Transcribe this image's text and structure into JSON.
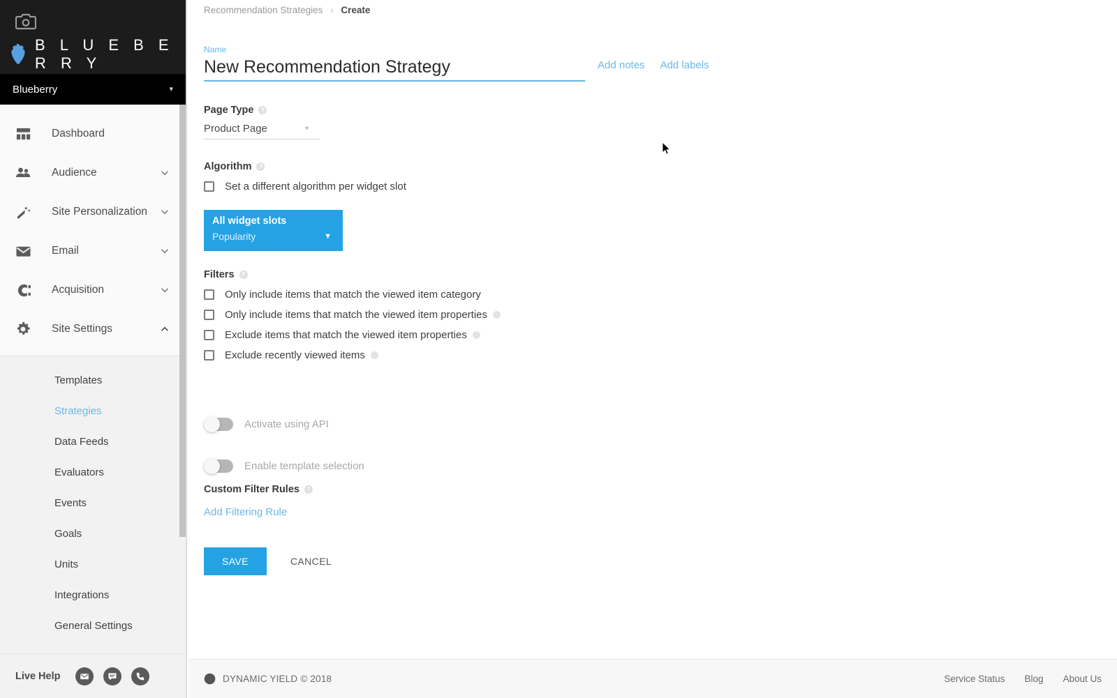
{
  "sidebar": {
    "brand": {
      "camera_icon": "camera-icon",
      "berry_icon": "blueberry-icon",
      "logo_text": "B L U E B E R R Y"
    },
    "site_selector": {
      "site_name": "Blueberry",
      "caret": "▾"
    },
    "nav_items": [
      {
        "label": "Dashboard",
        "icon": "dashboard-icon",
        "chevron": ""
      },
      {
        "label": "Audience",
        "icon": "people-icon",
        "chevron": "⌄"
      },
      {
        "label": "Site Personalization",
        "icon": "magic-wand-icon",
        "chevron": "⌄"
      },
      {
        "label": "Email",
        "icon": "envelope-icon",
        "chevron": "⌄"
      },
      {
        "label": "Acquisition",
        "icon": "magnet-icon",
        "chevron": "⌄"
      },
      {
        "label": "Site Settings",
        "icon": "gear-icon",
        "chevron": "⌃"
      }
    ],
    "sub_items": [
      {
        "label": "Templates",
        "active": false
      },
      {
        "label": "Strategies",
        "active": true
      },
      {
        "label": "Data Feeds",
        "active": false
      },
      {
        "label": "Evaluators",
        "active": false
      },
      {
        "label": "Events",
        "active": false
      },
      {
        "label": "Goals",
        "active": false
      },
      {
        "label": "Units",
        "active": false
      },
      {
        "label": "Integrations",
        "active": false
      },
      {
        "label": "General Settings",
        "active": false
      }
    ],
    "live_help": {
      "label": "Live Help",
      "icons": [
        "mail-icon",
        "chat-icon",
        "phone-icon"
      ]
    }
  },
  "breadcrumb": {
    "parent": "Recommendation Strategies",
    "separator": "›",
    "current": "Create"
  },
  "name_field": {
    "label": "Name",
    "value": "New Recommendation Strategy",
    "placeholder": "Enter strategy name"
  },
  "header_actions": {
    "add_notes": "Add notes",
    "add_labels": "Add labels"
  },
  "page_type": {
    "title": "Page Type",
    "help": "?",
    "selected": "Product Page",
    "caret": "▾"
  },
  "algorithm": {
    "title": "Algorithm",
    "help": "?",
    "per_slot_checkbox": "Set a different algorithm per widget slot",
    "widget_card": {
      "title": "All widget slots",
      "algorithm": "Popularity",
      "caret": "▼"
    }
  },
  "filters": {
    "title": "Filters",
    "help": "?",
    "options": [
      {
        "label": "Only include items that match the viewed item category",
        "has_help": false
      },
      {
        "label": "Only include items that match the viewed item properties",
        "has_help": true
      },
      {
        "label": "Exclude items that match the viewed item properties",
        "has_help": true
      },
      {
        "label": "Exclude recently viewed items",
        "has_help": true
      }
    ]
  },
  "toggles": [
    {
      "label": "Activate using API",
      "on": false
    },
    {
      "label": "Enable template selection",
      "on": false
    }
  ],
  "custom_filter_rules": {
    "title": "Custom Filter Rules",
    "help": "?",
    "add_link": "Add Filtering Rule"
  },
  "form_actions": {
    "save": "SAVE",
    "cancel": "CANCEL"
  },
  "footer": {
    "logo": "dynamic-yield-logo",
    "copyright": "DYNAMIC YIELD © 2018",
    "links": [
      "Service Status",
      "Blog",
      "About Us"
    ]
  },
  "colors": {
    "accent_blue": "#25a2e4",
    "link_blue": "#6cb6e8",
    "sidebar_bg": "#f2f2f2",
    "brand_bg": "#1c1c1c"
  }
}
